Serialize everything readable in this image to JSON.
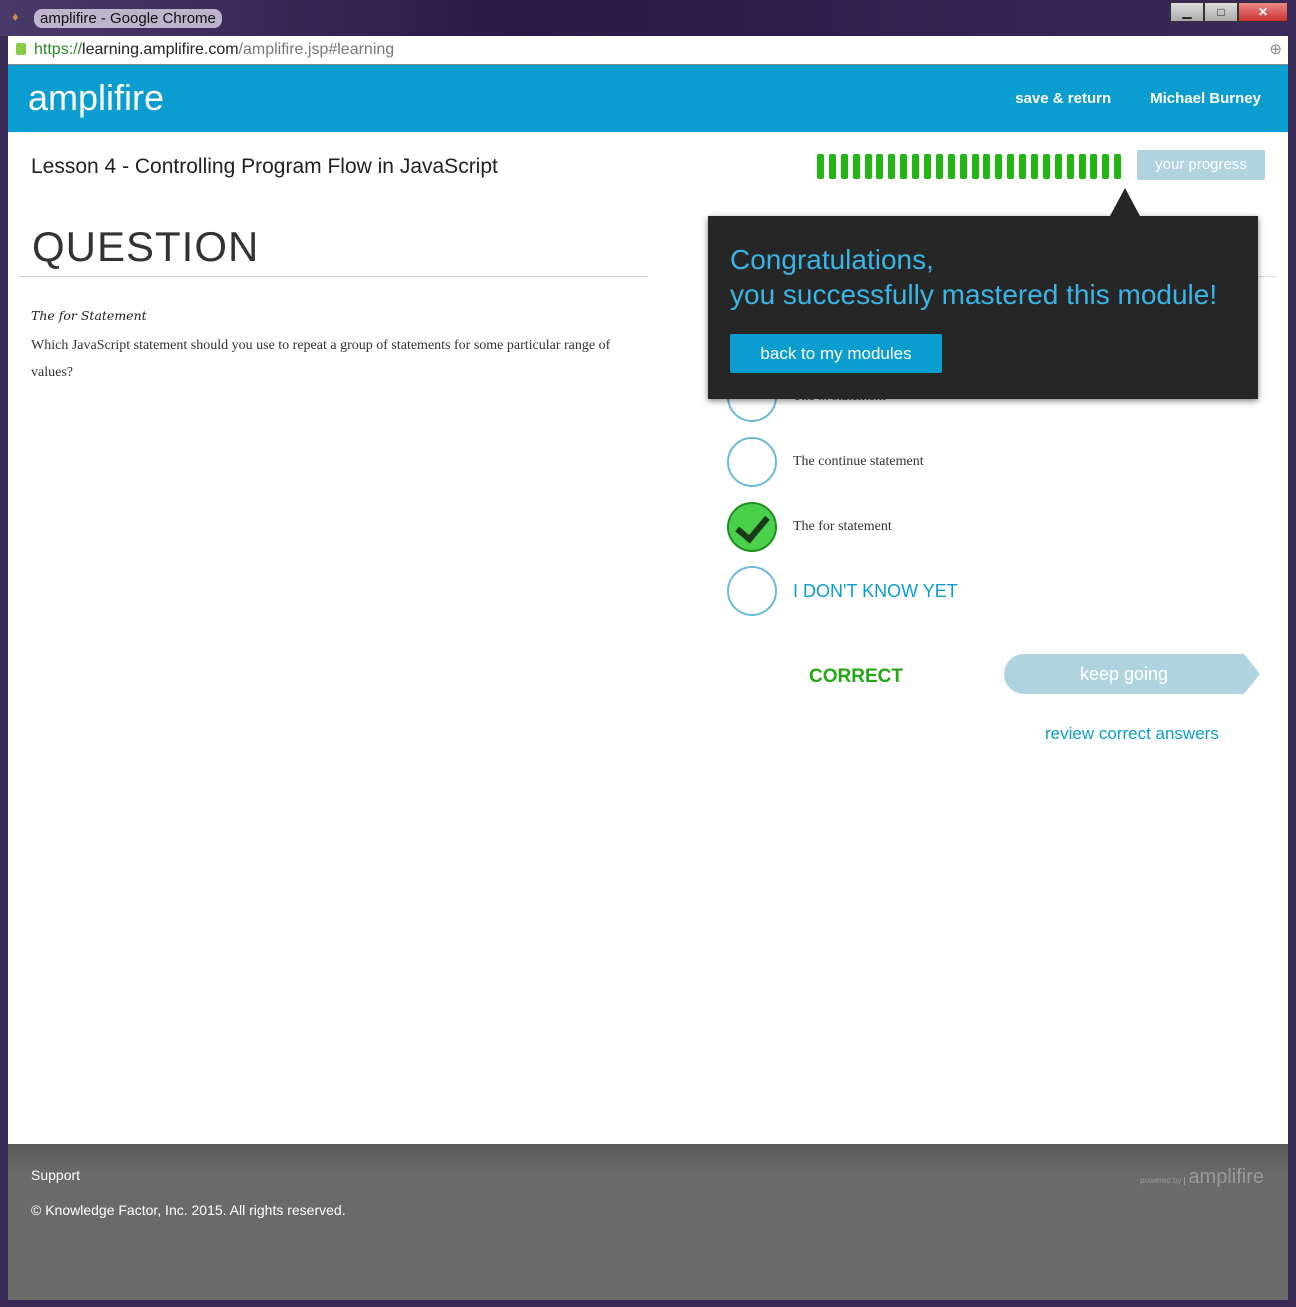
{
  "window": {
    "title": "amplifire - Google Chrome",
    "url_scheme": "https://",
    "url_domain": "learning.amplifire.com",
    "url_path": "/amplifire.jsp#learning"
  },
  "header": {
    "logo": "amplifire",
    "save_return": "save & return",
    "user": "Michael Burney"
  },
  "lesson": {
    "title": "Lesson 4 - Controlling Program Flow in JavaScript",
    "progress_segments": 26,
    "progress_filled": 26,
    "your_progress": "your progress"
  },
  "question": {
    "heading": "QUESTION",
    "title": "The for Statement",
    "text": "Which JavaScript statement should you use to repeat a group of statements for some particular range of values?"
  },
  "options": [
    {
      "label": "The ... statement",
      "state": "empty"
    },
    {
      "label": "The continue statement",
      "state": "empty"
    },
    {
      "label": "The for statement",
      "state": "correct"
    }
  ],
  "idk": "I DON'T KNOW YET",
  "result": "CORRECT",
  "keep_going": "keep going",
  "review": "review correct answers",
  "popup": {
    "line1": "Congratulations,",
    "line2": "you successfully mastered this module!",
    "button": "back to my modules"
  },
  "footer": {
    "support": "Support",
    "copyright": "© Knowledge Factor, Inc. 2015. All rights reserved.",
    "powered": "powered by",
    "brand": "amplifire"
  },
  "colors": {
    "brand": "#0b9dd0",
    "success": "#22b514"
  }
}
